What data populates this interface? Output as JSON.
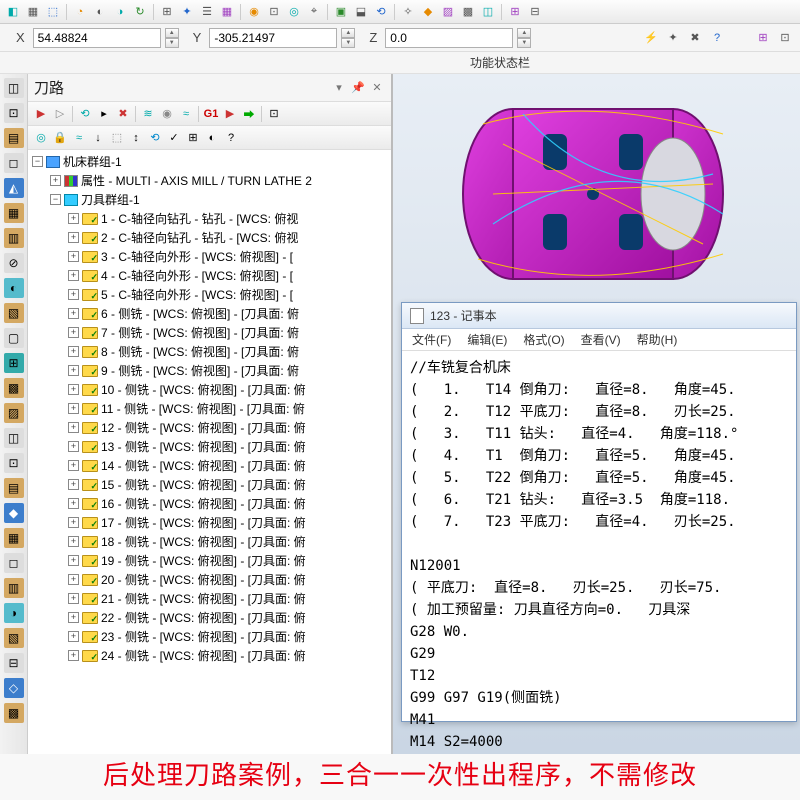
{
  "coords": {
    "x_label": "X",
    "x": "54.48824",
    "y_label": "Y",
    "y": "-305.21497",
    "z_label": "Z",
    "z": "0.0"
  },
  "status_label": "功能状态栏",
  "panel": {
    "title": "刀路",
    "g1": "G1"
  },
  "tree": {
    "root": "机床群组-1",
    "attr": "属性 - MULTI - AXIS  MILL / TURN  LATHE 2",
    "toolgroup": "刀具群组-1",
    "ops": [
      "1 - C-轴径向钻孔 - 钻孔 - [WCS: 俯视",
      "2 - C-轴径向钻孔 - 钻孔 - [WCS: 俯视",
      "3 - C-轴径向外形 - [WCS: 俯视图] - [",
      "4 - C-轴径向外形 - [WCS: 俯视图] - [",
      "5 - C-轴径向外形 - [WCS: 俯视图] - [",
      "6 - 侧铣 - [WCS: 俯视图] - [刀具面: 俯",
      "7 - 侧铣 - [WCS: 俯视图] - [刀具面: 俯",
      "8 - 侧铣 - [WCS: 俯视图] - [刀具面: 俯",
      "9 - 侧铣 - [WCS: 俯视图] - [刀具面: 俯",
      "10 - 侧铣 - [WCS: 俯视图] - [刀具面: 俯",
      "11 - 侧铣 - [WCS: 俯视图] - [刀具面: 俯",
      "12 - 侧铣 - [WCS: 俯视图] - [刀具面: 俯",
      "13 - 侧铣 - [WCS: 俯视图] - [刀具面: 俯",
      "14 - 侧铣 - [WCS: 俯视图] - [刀具面: 俯",
      "15 - 侧铣 - [WCS: 俯视图] - [刀具面: 俯",
      "16 - 侧铣 - [WCS: 俯视图] - [刀具面: 俯",
      "17 - 侧铣 - [WCS: 俯视图] - [刀具面: 俯",
      "18 - 侧铣 - [WCS: 俯视图] - [刀具面: 俯",
      "19 - 侧铣 - [WCS: 俯视图] - [刀具面: 俯",
      "20 - 侧铣 - [WCS: 俯视图] - [刀具面: 俯",
      "21 - 侧铣 - [WCS: 俯视图] - [刀具面: 俯",
      "22 - 侧铣 - [WCS: 俯视图] - [刀具面: 俯",
      "23 - 侧铣 - [WCS: 俯视图] - [刀具面: 俯",
      "24 - 侧铣 - [WCS: 俯视图] - [刀具面: 俯"
    ]
  },
  "notepad": {
    "title": "123 - 记事本",
    "menu": [
      "文件(F)",
      "编辑(E)",
      "格式(O)",
      "查看(V)",
      "帮助(H)"
    ],
    "body": "//车铣复合机床\n(   1.   T14 倒角刀:   直径=8.   角度=45.\n(   2.   T12 平底刀:   直径=8.   刃长=25.\n(   3.   T11 钻头:   直径=4.   角度=118.°\n(   4.   T1  倒角刀:   直径=5.   角度=45.\n(   5.   T22 倒角刀:   直径=5.   角度=45.\n(   6.   T21 钻头:   直径=3.5  角度=118.\n(   7.   T23 平底刀:   直径=4.   刃长=25.\n\nN12001\n( 平底刀:  直径=8.   刃长=25.   刃长=75.\n( 加工预留量: 刀具直径方向=0.   刀具深\nG28 W0.\nG29\nT12\nG99 G97 G19(侧面铣)\nM41\nM14 S2=4000"
  },
  "caption": "后处理刀路案例，三合一一次性出程序，不需修改"
}
